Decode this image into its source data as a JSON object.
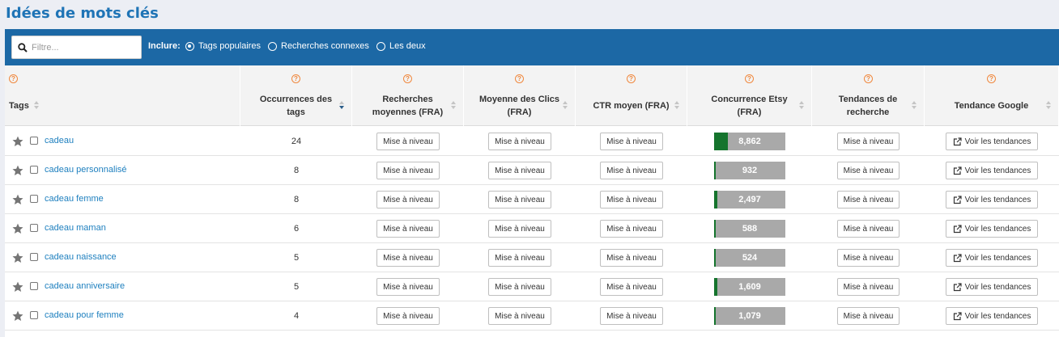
{
  "page": {
    "title": "Idées de mots clés"
  },
  "toolbar": {
    "filter_placeholder": "Filtre...",
    "include_label": "Inclure:",
    "options": [
      {
        "label": "Tags populaires",
        "selected": true
      },
      {
        "label": "Recherches connexes",
        "selected": false
      },
      {
        "label": "Les deux",
        "selected": false
      }
    ]
  },
  "colors": {
    "brand": "#1f74b6",
    "toolbar": "#1c68a5",
    "link": "#1f80bf",
    "help": "#f0883e",
    "competition_fill": "#15742d",
    "competition_bg": "#a9a9a9"
  },
  "columns": [
    {
      "label": "Tags",
      "help": "?"
    },
    {
      "label": "Occurrences des tags",
      "help": "?"
    },
    {
      "label": "Recherches moyennes (FRA)",
      "help": "?"
    },
    {
      "label": "Moyenne des Clics (FRA)",
      "help": "?"
    },
    {
      "label": "CTR moyen (FRA)",
      "help": "?"
    },
    {
      "label": "Concurrence Etsy (FRA)",
      "help": "?"
    },
    {
      "label": "Tendances de recherche",
      "help": "?"
    },
    {
      "label": "Tendance Google",
      "help": "?"
    }
  ],
  "sort": {
    "column": "Occurrences des tags",
    "direction": "desc"
  },
  "buttons": {
    "upgrade": "Mise à niveau",
    "trends": "Voir les tendances"
  },
  "rows": [
    {
      "tag": "cadeau",
      "occurrences": "24",
      "competition": "8,862",
      "competition_level": 0.19
    },
    {
      "tag": "cadeau personnalisé",
      "occurrences": "8",
      "competition": "932",
      "competition_level": 0.02
    },
    {
      "tag": "cadeau femme",
      "occurrences": "8",
      "competition": "2,497",
      "competition_level": 0.05
    },
    {
      "tag": "cadeau maman",
      "occurrences": "6",
      "competition": "588",
      "competition_level": 0.01
    },
    {
      "tag": "cadeau naissance",
      "occurrences": "5",
      "competition": "524",
      "competition_level": 0.01
    },
    {
      "tag": "cadeau anniversaire",
      "occurrences": "5",
      "competition": "1,609",
      "competition_level": 0.04
    },
    {
      "tag": "cadeau pour femme",
      "occurrences": "4",
      "competition": "1,079",
      "competition_level": 0.02
    }
  ]
}
